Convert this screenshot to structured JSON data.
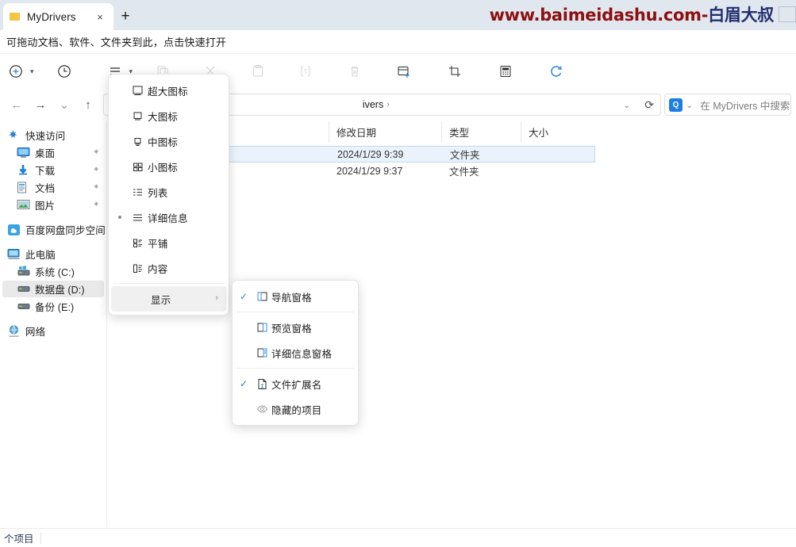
{
  "tab": {
    "title": "MyDrivers",
    "close_label": "×",
    "new_tab_label": "+",
    "favicon_name": "folder-icon"
  },
  "watermark": {
    "url": "www.baimeidashu.com-",
    "cn": "白眉大叔"
  },
  "drag_hint": {
    "text": "可拖动文档、软件、文件夹到此，点击快速打开"
  },
  "toolbar": {
    "buttons": [
      {
        "name": "new-item-button",
        "label": "新建",
        "caret": true,
        "disabled": false
      },
      {
        "name": "history-button",
        "label": "历史",
        "caret": false,
        "disabled": false
      },
      {
        "name": "sort-view-button",
        "label": "查看",
        "caret": true,
        "disabled": false
      },
      {
        "name": "copy-button",
        "label": "复制",
        "caret": false,
        "disabled": true
      },
      {
        "name": "cut-button",
        "label": "剪切",
        "caret": false,
        "disabled": true
      },
      {
        "name": "paste-button",
        "label": "粘贴",
        "caret": false,
        "disabled": true
      },
      {
        "name": "rename-button",
        "label": "重命名",
        "caret": false,
        "disabled": true
      },
      {
        "name": "delete-button",
        "label": "删除",
        "caret": false,
        "disabled": true
      },
      {
        "name": "new-folder-button",
        "label": "新建文件夹",
        "caret": false,
        "disabled": false
      },
      {
        "name": "screenshot-button",
        "label": "截图",
        "caret": false,
        "disabled": false
      },
      {
        "name": "calculator-button",
        "label": "计算器",
        "caret": false,
        "disabled": false
      },
      {
        "name": "refresh-button",
        "label": "刷新",
        "caret": false,
        "disabled": false
      }
    ]
  },
  "address_bar": {
    "back_label": "←",
    "forward_label": "→",
    "recent_label": "⌄",
    "up_label": "↑",
    "crumb_text": "ivers",
    "crumb_sep": "›",
    "dropdown_label": "⌄",
    "refresh_label": "⟳"
  },
  "search": {
    "badge": "Q",
    "caret": "⌄",
    "placeholder": "在 MyDrivers 中搜索"
  },
  "sidebar": {
    "items": [
      {
        "name": "sidebar-item-quick-access",
        "label": "快速访问",
        "icon": "star-pin-icon",
        "sub": false,
        "pin": false,
        "selected": false
      },
      {
        "name": "sidebar-item-desktop",
        "label": "桌面",
        "icon": "desktop-icon",
        "sub": true,
        "pin": true,
        "selected": false
      },
      {
        "name": "sidebar-item-downloads",
        "label": "下载",
        "icon": "download-icon",
        "sub": true,
        "pin": true,
        "selected": false
      },
      {
        "name": "sidebar-item-documents",
        "label": "文档",
        "icon": "document-icon",
        "sub": true,
        "pin": true,
        "selected": false
      },
      {
        "name": "sidebar-item-pictures",
        "label": "图片",
        "icon": "picture-icon",
        "sub": true,
        "pin": true,
        "selected": false
      },
      {
        "name": "sidebar-item-baidu-netdisk",
        "label": "百度网盘同步空间",
        "icon": "cloud-sync-icon",
        "sub": false,
        "pin": false,
        "selected": false
      },
      {
        "name": "sidebar-item-this-pc",
        "label": "此电脑",
        "icon": "pc-icon",
        "sub": false,
        "pin": false,
        "selected": false
      },
      {
        "name": "sidebar-item-drive-c",
        "label": "系统 (C:)",
        "icon": "windows-drive-icon",
        "sub": true,
        "pin": false,
        "selected": false
      },
      {
        "name": "sidebar-item-drive-d",
        "label": "数据盘 (D:)",
        "icon": "drive-icon",
        "sub": true,
        "pin": false,
        "selected": true
      },
      {
        "name": "sidebar-item-drive-e",
        "label": "备份 (E:)",
        "icon": "drive-icon",
        "sub": true,
        "pin": false,
        "selected": false
      },
      {
        "name": "sidebar-item-network",
        "label": "网络",
        "icon": "network-icon",
        "sub": false,
        "pin": false,
        "selected": false
      }
    ]
  },
  "file_list": {
    "columns": [
      {
        "name": "column-name",
        "label": ""
      },
      {
        "name": "column-date-modified",
        "label": "修改日期"
      },
      {
        "name": "column-type",
        "label": "类型"
      },
      {
        "name": "column-size",
        "label": "大小"
      }
    ],
    "rows": [
      {
        "date": "2024/1/29 9:39",
        "type": "文件夹",
        "size": "",
        "selected": true
      },
      {
        "date": "2024/1/29 9:37",
        "type": "文件夹",
        "size": "",
        "selected": false
      }
    ]
  },
  "status_bar": {
    "text": "个项目"
  },
  "view_menu": {
    "items": [
      {
        "name": "menu-item-extra-large-icons",
        "label": "超大图标",
        "icon": "extra-large-icons-icon",
        "bullet": false
      },
      {
        "name": "menu-item-large-icons",
        "label": "大图标",
        "icon": "large-icons-icon",
        "bullet": false
      },
      {
        "name": "menu-item-medium-icons",
        "label": "中图标",
        "icon": "medium-icons-icon",
        "bullet": false
      },
      {
        "name": "menu-item-small-icons",
        "label": "小图标",
        "icon": "small-icons-icon",
        "bullet": false
      },
      {
        "name": "menu-item-list",
        "label": "列表",
        "icon": "list-icon",
        "bullet": false
      },
      {
        "name": "menu-item-details",
        "label": "详细信息",
        "icon": "details-icon",
        "bullet": true
      },
      {
        "name": "menu-item-tiles",
        "label": "平铺",
        "icon": "tiles-icon",
        "bullet": false
      },
      {
        "name": "menu-item-content",
        "label": "内容",
        "icon": "content-icon",
        "bullet": false
      }
    ],
    "show_item": {
      "name": "menu-item-show",
      "label": "显示",
      "arrow": "›"
    }
  },
  "show_submenu": {
    "items": [
      {
        "name": "submenu-item-navigation-pane",
        "label": "导航窗格",
        "icon": "navigation-pane-icon",
        "checked": true,
        "sep_after": true
      },
      {
        "name": "submenu-item-preview-pane",
        "label": "预览窗格",
        "icon": "preview-pane-icon",
        "checked": false,
        "sep_after": false
      },
      {
        "name": "submenu-item-details-pane",
        "label": "详细信息窗格",
        "icon": "details-pane-icon",
        "checked": false,
        "sep_after": true
      },
      {
        "name": "submenu-item-file-extensions",
        "label": "文件扩展名",
        "icon": "file-extension-icon",
        "checked": true,
        "sep_after": false
      },
      {
        "name": "submenu-item-hidden-items",
        "label": "隐藏的项目",
        "icon": "hidden-items-icon",
        "checked": false,
        "sep_after": false
      }
    ],
    "check_glyph": "✓"
  },
  "colors": {
    "accent": "#1e7fe0",
    "tabstrip_bg": "#e1e7ef",
    "selection": "#eaf3fb",
    "watermark_red": "#8c1010",
    "watermark_blue": "#232f6e"
  }
}
